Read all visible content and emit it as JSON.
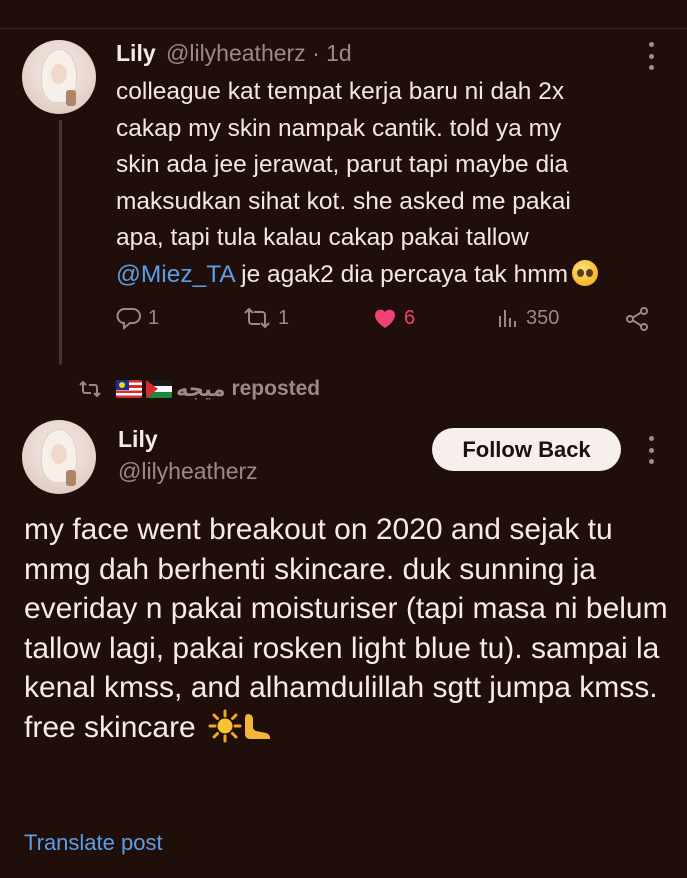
{
  "tweet1": {
    "name": "Lily",
    "handle_time": "@lilyheatherz · 1d",
    "text_before_mention": "colleague kat tempat kerja baru ni dah 2x\ncakap my skin nampak cantik. told ya my\nskin ada jee jerawat, parut tapi maybe dia\nmaksudkan sihat kot. she asked me pakai\napa, tapi tula kalau cakap pakai tallow\n",
    "mention": "@Miez_TA",
    "text_after_mention": " je agak2 dia percaya tak hmm",
    "emoji": "pleading-face",
    "actions": {
      "replies": "1",
      "reposts": "1",
      "likes": "6",
      "views": "350"
    }
  },
  "repost": {
    "by": "ميجه",
    "label": "reposted",
    "flags": [
      "malaysia-flag",
      "palestine-flag"
    ]
  },
  "tweet2": {
    "name": "Lily",
    "handle": "@lilyheatherz",
    "follow_label": "Follow Back",
    "text": "my face went breakout on 2020 and sejak tu mmg dah berhenti skincare. duk sunning ja everiday n pakai moisturiser (tapi masa ni belum tallow lagi, pakai rosken light blue tu). sampai la kenal kmss, and alhamdulillah sgtt jumpa kmss. free skincare",
    "emojis": [
      "sun-icon",
      "foot-icon"
    ],
    "translate_label": "Translate post"
  },
  "colors": {
    "background": "#200e0a",
    "like": "#f0407a",
    "link": "#5a9ee6",
    "muted": "#9c8984"
  }
}
